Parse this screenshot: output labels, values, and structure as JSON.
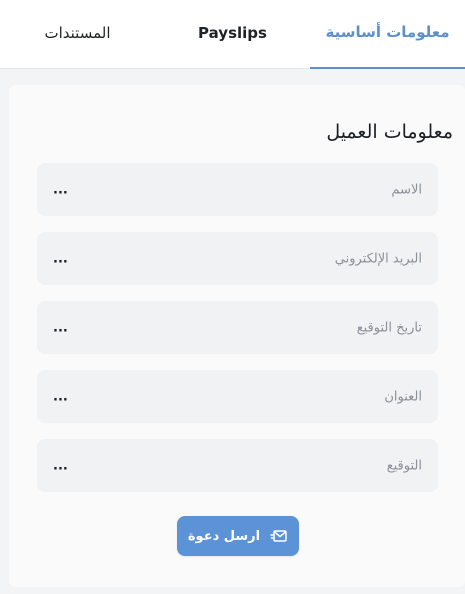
{
  "tabs": [
    {
      "label": "معلومات أساسية",
      "active": true
    },
    {
      "label": "Payslips",
      "active": false
    },
    {
      "label": "المستندات",
      "active": false
    }
  ],
  "card": {
    "title": "معلومات العميل"
  },
  "fields": [
    {
      "label": "الاسم",
      "value": "..."
    },
    {
      "label": "البريد الإلكتروني",
      "value": "..."
    },
    {
      "label": "تاريخ التوقيع",
      "value": "..."
    },
    {
      "label": "العنوان",
      "value": "..."
    },
    {
      "label": "التوقيع",
      "value": "..."
    }
  ],
  "send_button": {
    "label": "ارسل دعوة",
    "icon": "mail-send-icon"
  },
  "colors": {
    "accent": "#5b8fd0",
    "button": "#5b93d6"
  }
}
